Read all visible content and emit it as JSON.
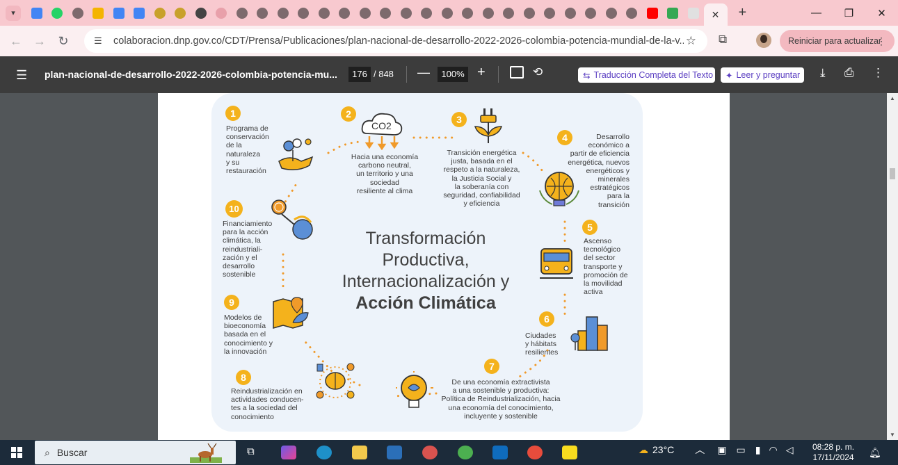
{
  "browser": {
    "url": "colaboracion.dnp.gov.co/CDT/Prensa/Publicaciones/plan-nacional-de-desarrollo-2022-2026-colombia-potencia-mundial-de-la-v...",
    "update_button": "Reiniciar para actualizar",
    "active_tab_close": "✕",
    "new_tab": "+",
    "tab_icons": [
      "calendar-icon",
      "whatsapp-icon",
      "generic-site-icon",
      "drive-icon",
      "docs-icon",
      "docs-icon",
      "colombia-seal-icon",
      "colombia-seal-icon",
      "chatgpt-icon",
      "site-icon",
      "generic-site-icon",
      "generic-site-icon",
      "generic-site-icon",
      "generic-site-icon",
      "generic-site-icon",
      "generic-site-icon",
      "generic-site-icon",
      "generic-site-icon",
      "generic-site-icon",
      "generic-site-icon",
      "generic-site-icon",
      "generic-site-icon",
      "generic-site-icon",
      "generic-site-icon",
      "generic-site-icon",
      "generic-site-icon",
      "generic-site-icon",
      "generic-site-icon",
      "generic-site-icon",
      "generic-site-icon",
      "youtube-icon",
      "plus-green-icon",
      "pdf-icon"
    ],
    "accent_color": "#f8c9cf"
  },
  "pdf": {
    "title": "plan-nacional-de-desarrollo-2022-2026-colombia-potencia-mu...",
    "page_current": "176",
    "page_total": "/ 848",
    "zoom": "100%",
    "translate_button": "Traducción Completa del Texto",
    "ask_button": "Leer y preguntar"
  },
  "infographic": {
    "title_lines": [
      "Transformación",
      "Productiva,",
      "Internacionalización y"
    ],
    "title_bold": "Acción Climática",
    "items": [
      {
        "num": "1",
        "lines": [
          "Programa de",
          "conservación",
          "de la",
          "naturaleza",
          "y su",
          "restauración"
        ]
      },
      {
        "num": "2",
        "lines": [
          "Hacia una economía",
          "carbono neutral,",
          "un territorio y una",
          "sociedad",
          "resiliente al clima"
        ],
        "icon_text": "CO2"
      },
      {
        "num": "3",
        "lines": [
          "Transición energética",
          "justa, basada en el",
          "respeto a la naturaleza,",
          "la Justicia Social y",
          "la soberanía con",
          "seguridad, confiabilidad",
          "y eficiencia"
        ]
      },
      {
        "num": "4",
        "lines": [
          "Desarrollo",
          "económico a",
          "partir de eficiencia",
          "energética, nuevos",
          "energéticos y",
          "minerales",
          "estratégicos",
          "para la",
          "transición"
        ]
      },
      {
        "num": "5",
        "lines": [
          "Ascenso",
          "tecnológico",
          "del sector",
          "transporte y",
          "promoción de",
          "la movilidad",
          "activa"
        ]
      },
      {
        "num": "6",
        "lines": [
          "Ciudades",
          "y hábitats",
          "resilientes"
        ]
      },
      {
        "num": "7",
        "lines": [
          "De una economía extractivista",
          "a una sostenible y productiva:",
          "Política de Reindustrialización, hacia",
          "una economía del conocimiento,",
          "incluyente y sostenible"
        ]
      },
      {
        "num": "8",
        "lines": [
          "Reindustrialización en",
          "actividades conducen-",
          "tes a la sociedad del",
          "conocimiento"
        ]
      },
      {
        "num": "9",
        "lines": [
          "Modelos de",
          "bioeconomía",
          "basada en el",
          "conocimiento y",
          "la innovación"
        ]
      },
      {
        "num": "10",
        "lines": [
          "Financiamiento",
          "para la acción",
          "climática, la",
          "reindustriali-",
          "zación y el",
          "desarrollo",
          "sostenible"
        ]
      }
    ]
  },
  "taskbar": {
    "search_placeholder": "Buscar",
    "weather": "23°C",
    "time": "08:28 p. m.",
    "date": "17/11/2024"
  }
}
